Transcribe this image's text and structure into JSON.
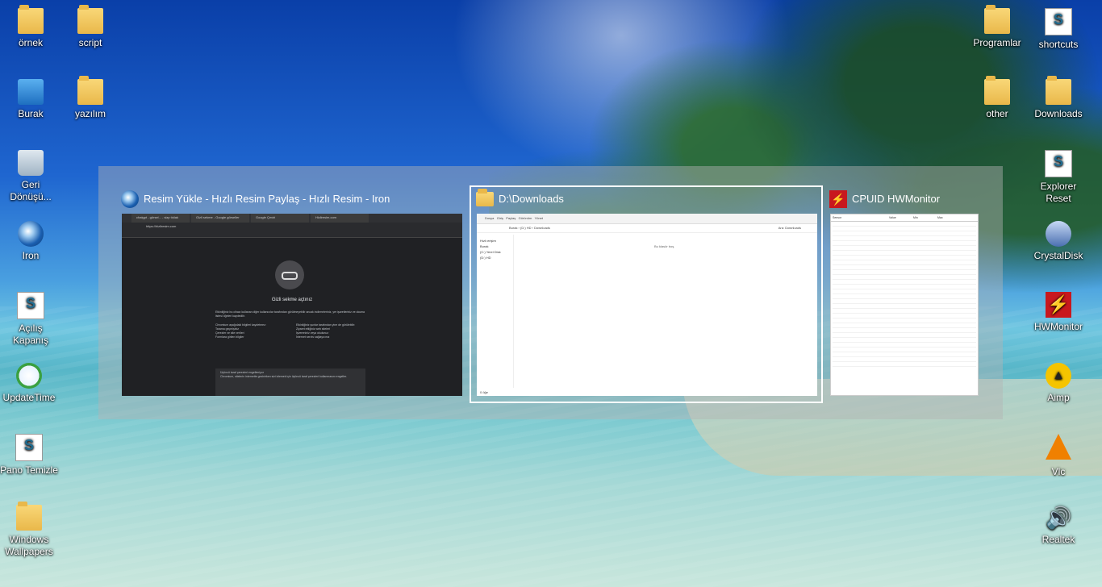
{
  "desktop": {
    "left_icons": [
      {
        "label": "örnek",
        "icon": "folder-icon"
      },
      {
        "label": "script",
        "icon": "folder-icon"
      },
      {
        "label": "Burak",
        "icon": "computer-icon"
      },
      {
        "label": "yazılım",
        "icon": "folder-icon"
      },
      {
        "label": "Geri Dönüşü...",
        "icon": "recycle-bin-icon"
      },
      {
        "label": "Iron",
        "icon": "iron-browser-icon"
      },
      {
        "label": "Açılış Kapanış",
        "icon": "script-file-icon"
      },
      {
        "label": "UpdateTime",
        "icon": "clock-icon"
      },
      {
        "label": "Pano Temizle",
        "icon": "script-file-icon"
      },
      {
        "label": "Windows Wallpapers",
        "icon": "wallpaper-folder-icon"
      }
    ],
    "right_icons": [
      {
        "label": "Programlar",
        "icon": "folder-icon"
      },
      {
        "label": "shortcuts",
        "icon": "shortcut-file-icon"
      },
      {
        "label": "other",
        "icon": "folder-icon"
      },
      {
        "label": "Downloads",
        "icon": "folder-icon"
      },
      {
        "label": "Explorer Reset",
        "icon": "script-file-icon"
      },
      {
        "label": "CrystalDisk",
        "icon": "crystaldisk-icon"
      },
      {
        "label": "HWMonitor",
        "icon": "hwmonitor-icon"
      },
      {
        "label": "Aimp",
        "icon": "aimp-icon"
      },
      {
        "label": "Vlc",
        "icon": "vlc-icon"
      },
      {
        "label": "Realtek",
        "icon": "speaker-icon"
      }
    ]
  },
  "task_switcher": {
    "windows": [
      {
        "title": "Resim Yükle - Hızlı Resim Paylaş - Hızlı Resim - Iron",
        "tabs": [
          "chatgpt - görsel... - sizp tıklak",
          "Gizli sekme - Google görseller",
          "Google Çeviri",
          "Hizliresim.com"
        ],
        "url": "https://hizliresim.com",
        "heading": "Gizli sekme açtınız",
        "body": "Etkinliğiniz bu cihazı kullanan diğer kullanıcılar tarafından görülmeyebilir ancak indirmeleriniz, yer işaretleriniz ve okuma listesi öğeleri kaydedilir.",
        "list_left_title": "Chromium aşağıdaki bilgileri kaydetmez:",
        "list_left": [
          "Tarama geçmişiniz",
          "Çerezler ve site verileri",
          "Formlara girilen bilgiler"
        ],
        "list_right_title": "Etkinliğiniz şunlar tarafından yine de görülebilir:",
        "list_right": [
          "Ziyaret ettiğiniz web siteleri",
          "İşvereniniz veya okulunuz",
          "İnternet servis sağlayıcınız"
        ],
        "box_title": "Üçüncü taraf çerezleri engelleniyor",
        "box_text": "Chromium, sitelerin internette gezinirken sizi izlemek için üçüncü taraf çerezleri kullanmasını engeller."
      },
      {
        "title": "D:\\Downloads",
        "ribbon": [
          "Dosya",
          "Giriş",
          "Paylaş",
          "Görünüm",
          "Yönet"
        ],
        "address": "Burak › (D:) HD › Downloads",
        "search_placeholder": "Ara: Downloads",
        "nav": [
          "Hızlı erişim",
          "Burak",
          "(C:) Yerel Disk",
          "(D:) HD"
        ],
        "empty_text": "Bu klasör boş.",
        "status": "0 öğe"
      },
      {
        "title": "CPUID HWMonitor",
        "columns": [
          "Sensor",
          "Value",
          "Min",
          "Max"
        ]
      }
    ]
  }
}
